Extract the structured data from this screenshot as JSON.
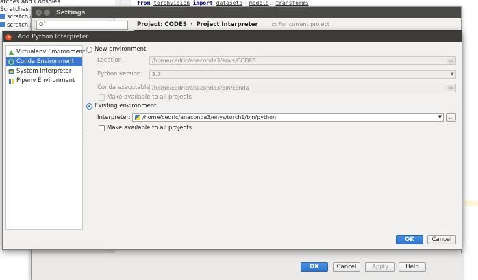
{
  "ide": {
    "project_items": [
      "atches and Consoles",
      "Scratches",
      "scratch.c",
      "scratch.p"
    ],
    "code_line": {
      "from": "from",
      "module": "torchvision",
      "import": "import",
      "names": [
        "datasets",
        "models",
        "transforms"
      ]
    }
  },
  "settings": {
    "title": "Settings",
    "search_placeholder": "Qˇ",
    "breadcrumb": [
      "Project: CODES",
      "Project Interpreter"
    ],
    "breadcrumb_sep": "›",
    "for_current_project": "For current project",
    "buttons": {
      "ok": "OK",
      "cancel": "Cancel",
      "apply": "Apply",
      "help": "Help"
    }
  },
  "add_interpreter": {
    "title": "Add Python Interpreter",
    "nav": [
      {
        "label": "Virtualenv Environment",
        "icon": "virtualenv-icon",
        "selected": false
      },
      {
        "label": "Conda Environment",
        "icon": "conda-icon",
        "selected": true
      },
      {
        "label": "System Interpreter",
        "icon": "system-interpreter-icon",
        "selected": false
      },
      {
        "label": "Pipenv Environment",
        "icon": "pipenv-icon",
        "selected": false
      }
    ],
    "new_env": {
      "label": "New environment",
      "selected": false,
      "location_label": "Location:",
      "location_value": "/home/cedric/anaconda3/envs/CODES",
      "python_version_label": "Python version:",
      "python_version_value": "3.7",
      "conda_exe_label": "Conda executable:",
      "conda_exe_value": "/home/cedric/anaconda3/bin/conda",
      "make_available": "Make available to all projects"
    },
    "existing_env": {
      "label": "Existing environment",
      "selected": true,
      "interpreter_label": "Interpreter:",
      "interpreter_value": "/home/cedric/anaconda3/envs/torch1/bin/python",
      "browse_label": "...",
      "make_available": "Make available to all projects"
    },
    "buttons": {
      "ok": "OK",
      "cancel": "Cancel"
    }
  },
  "colors": {
    "accent": "#3b78d0",
    "titlebar": "#3d3c38",
    "dialog_bg": "#f2f1f0",
    "close_button": "#e95420"
  }
}
